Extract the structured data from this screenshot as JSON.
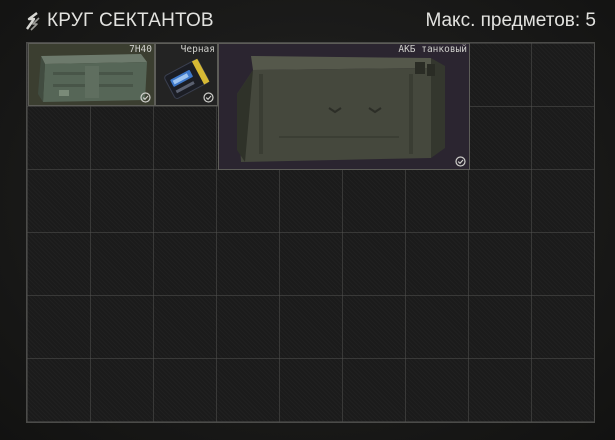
{
  "header": {
    "title": "КРУГ СЕКТАНТОВ",
    "max_items": "Макс. предметов: 5",
    "logo_icon": "cult-circle-icon"
  },
  "grid": {
    "columns": 9,
    "rows": 6
  },
  "items": [
    {
      "label": "7H40",
      "icon": "ammo-crate-icon",
      "found_in_raid": true,
      "background": "#3a3d2f"
    },
    {
      "label": "Черная",
      "icon": "keycard-icon",
      "found_in_raid": true,
      "background": "#232323"
    },
    {
      "label": "АКБ танковый",
      "icon": "tank-battery-icon",
      "found_in_raid": true,
      "background": "#2b2530"
    }
  ],
  "colors": {
    "background": "#1a1a19",
    "grid_line": "#4b4b49",
    "text": "#e2e2df",
    "selected_item_bg": "#2b2530"
  }
}
